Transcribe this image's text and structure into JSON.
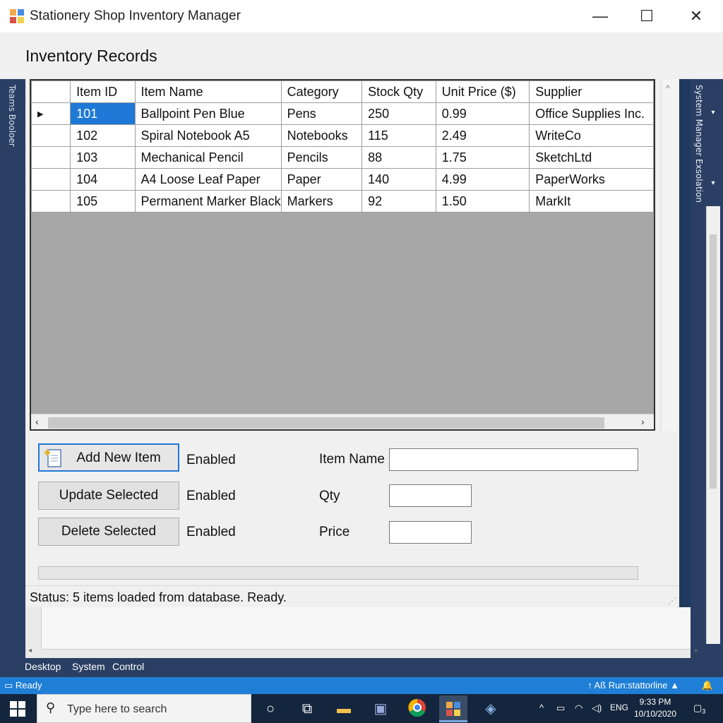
{
  "window": {
    "title": "Stationery Shop Inventory Manager",
    "heading": "Inventory Records"
  },
  "side_panels": {
    "left_label": "Teams Booloer",
    "right_label": "System Manager Exsolation"
  },
  "grid": {
    "columns": [
      "Item ID",
      "Item Name",
      "Category",
      "Stock Qty",
      "Unit Price ($)",
      "Supplier"
    ],
    "rows": [
      [
        "101",
        "Ballpoint Pen Blue",
        "Pens",
        "250",
        "0.99",
        "Office Supplies Inc."
      ],
      [
        "102",
        "Spiral Notebook A5",
        "Notebooks",
        "115",
        "2.49",
        "WriteCo"
      ],
      [
        "103",
        "Mechanical Pencil",
        "Pencils",
        "88",
        "1.75",
        "SketchLtd"
      ],
      [
        "104",
        "A4 Loose Leaf Paper",
        "Paper",
        "140",
        "4.99",
        "PaperWorks"
      ],
      [
        "105",
        "Permanent Marker Black",
        "Markers",
        "92",
        "1.50",
        "MarkIt"
      ]
    ],
    "selected_row": 0
  },
  "actions": {
    "add_label": "Add New Item",
    "update_label": "Update Selected",
    "delete_label": "Delete Selected",
    "add_state": "Enabled",
    "update_state": "Enabled",
    "delete_state": "Enabled"
  },
  "fields": {
    "item_name_label": "Item Name",
    "qty_label": "Qty",
    "price_label": "Price",
    "item_name_value": "",
    "qty_value": "",
    "price_value": ""
  },
  "status": {
    "text": "Status: 5 items loaded from database. Ready."
  },
  "ide": {
    "tabs": [
      "Desktop",
      "System",
      "Control"
    ],
    "status_left": "Ready",
    "status_right": "↑ Aß   Run:stattorline ▲"
  },
  "taskbar": {
    "search_placeholder": "Type here to search",
    "language": "ENG",
    "time": "9:33 PM",
    "date": "10/10/2020",
    "notification_count": "3"
  },
  "colors": {
    "accent": "#1e78d6",
    "ide_background": "#2a3f63",
    "taskbar": "#14263d",
    "grid_empty": "#a7a7a7"
  }
}
